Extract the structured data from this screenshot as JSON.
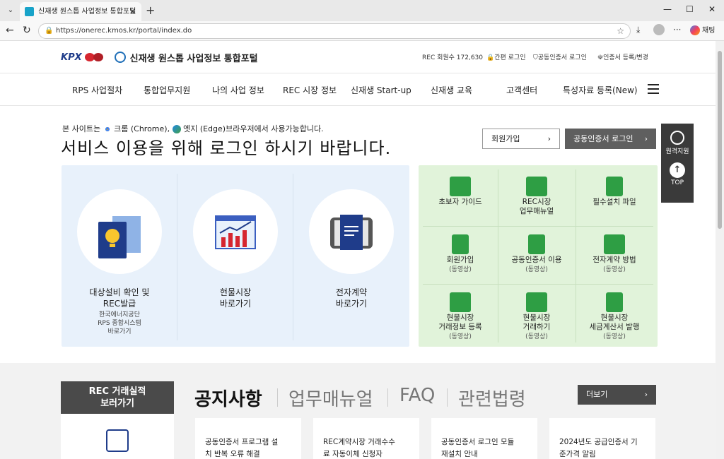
{
  "browser": {
    "tab_title": "신재생 원스톱 사업정보 통합포털",
    "url": "https://onerec.kmos.kr/portal/index.do",
    "chat_label": "채팅"
  },
  "header": {
    "logo_text": "KPX",
    "site_title": "신재생 원스톱 사업정보 통합포털",
    "members": "REC 회원수 172,630",
    "simple_login": "간편 로그인",
    "cert_login": "공동인증서 로그인",
    "cert_register": "인증서 등록/변경"
  },
  "menu": [
    "RPS 사업절차",
    "통합업무지원",
    "나의 사업 정보",
    "REC 시장 정보",
    "신재생 Start-up",
    "신재생 교육",
    "고객센터",
    "특성자료 등록(New)"
  ],
  "hero": {
    "notice_pre": "본 사이트는",
    "chrome": "크롬 (Chrome),",
    "edge": "엣지 (Edge)브라우저에서 사용가능합니다.",
    "title": "서비스 이용을 위해 로그인 하시기 바랍니다.",
    "join_button": "회원가입",
    "login_button": "공동인증서 로그인"
  },
  "side_widget": {
    "remote": "원격지원",
    "top": "TOP"
  },
  "quick_links": [
    {
      "label1": "대상설비 확인 및",
      "label2": "REC발급",
      "sub1": "한국에너지공단",
      "sub2": "RPS 종합시스템",
      "sub3": "바로가기"
    },
    {
      "label1": "현물시장",
      "label2": "바로가기"
    },
    {
      "label1": "전자계약",
      "label2": "바로가기"
    }
  ],
  "guides": [
    {
      "l1": "초보자 가이드",
      "l2": "",
      "s": ""
    },
    {
      "l1": "REC시장",
      "l2": "업무매뉴얼",
      "s": ""
    },
    {
      "l1": "필수설치 파일",
      "l2": "",
      "s": ""
    },
    {
      "l1": "회원가입",
      "l2": "",
      "s": "(동영상)"
    },
    {
      "l1": "공동인증서 이용",
      "l2": "",
      "s": "(동영상)"
    },
    {
      "l1": "전자계약 방법",
      "l2": "",
      "s": "(동영상)"
    },
    {
      "l1": "현물시장",
      "l2": "거래정보 등록",
      "s": "(동영상)"
    },
    {
      "l1": "현물시장",
      "l2": "거래하기",
      "s": "(동영상)"
    },
    {
      "l1": "현물시장",
      "l2": "세금계산서 발행",
      "s": "(동영상)"
    }
  ],
  "bottom": {
    "rec_line1": "REC 거래실적",
    "rec_line2": "보러가기",
    "tabs": [
      "공지사항",
      "업무매뉴얼",
      "FAQ",
      "관련법령"
    ],
    "more": "더보기",
    "cards": [
      {
        "l1": "공동인증서 프로그램 설",
        "l2": "치 반복 오류 해결"
      },
      {
        "l1": "REC계약시장 거래수수",
        "l2": "료 자동이체 신청자"
      },
      {
        "l1": "공동인증서 로그인 모듈",
        "l2": "재설치 안내"
      },
      {
        "l1": "2024년도 공급인증서 기",
        "l2": "준가격 알림"
      }
    ]
  },
  "colors": {
    "accent": "#1f3c8a",
    "brand_red": "#d6262f",
    "green_panel": "#e1f3da",
    "blue_panel": "#e8f1fb"
  }
}
